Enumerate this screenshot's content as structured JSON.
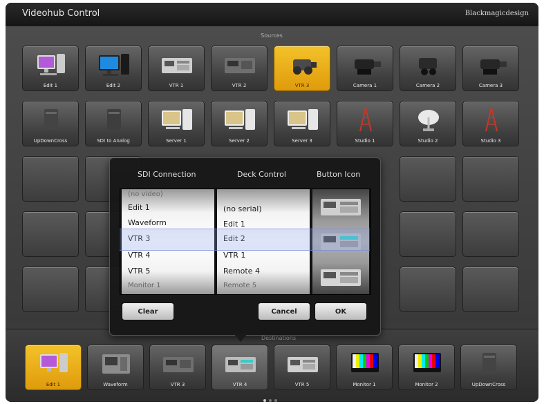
{
  "app": {
    "title": "Videohub Control",
    "brand": "Blackmagicdesign"
  },
  "sources": {
    "label": "Sources",
    "row1": [
      "Edit 1",
      "Edit 2",
      "VTR 1",
      "VTR 2",
      "VTR 3",
      "Camera 1",
      "Camera 2",
      "Camera 3"
    ],
    "row2": [
      "UpDownCross",
      "SDI to Analog",
      "Server 1",
      "Server 2",
      "Server 3",
      "Studio 1",
      "Studio 2",
      "Studio 3"
    ]
  },
  "destinations": {
    "label": "Destinations",
    "items": [
      "Edit 1",
      "Waveform",
      "VTR 3",
      "VTR 4",
      "VTR 5",
      "Monitor 1",
      "Monitor 2",
      "UpDownCross"
    ]
  },
  "dialog": {
    "headers": {
      "sdi": "SDI Connection",
      "deck": "Deck Control",
      "icon": "Button Icon"
    },
    "sdi_rows": [
      "(no video)",
      "Edit 1",
      "Waveform",
      "VTR 3",
      "VTR 4",
      "VTR 5",
      "Monitor 1"
    ],
    "deck_rows": [
      "(no serial)",
      "Edit 1",
      "Edit 2",
      "VTR 1",
      "Remote 4",
      "Remote 5"
    ],
    "selected_sdi": "VTR 3",
    "selected_deck": "Edit 2",
    "buttons": {
      "clear": "Clear",
      "cancel": "Cancel",
      "ok": "OK"
    }
  },
  "colors": {
    "selected": "#f0b41c",
    "panel": "#3b3b3b"
  },
  "icons": [
    "computer-icon",
    "monitor-icon",
    "vtr-deck-icon",
    "camera-icon",
    "converter-box-icon",
    "server-icon",
    "antenna-tower-icon",
    "satellite-dish-icon",
    "color-bars-monitor-icon",
    "waveform-monitor-icon"
  ]
}
